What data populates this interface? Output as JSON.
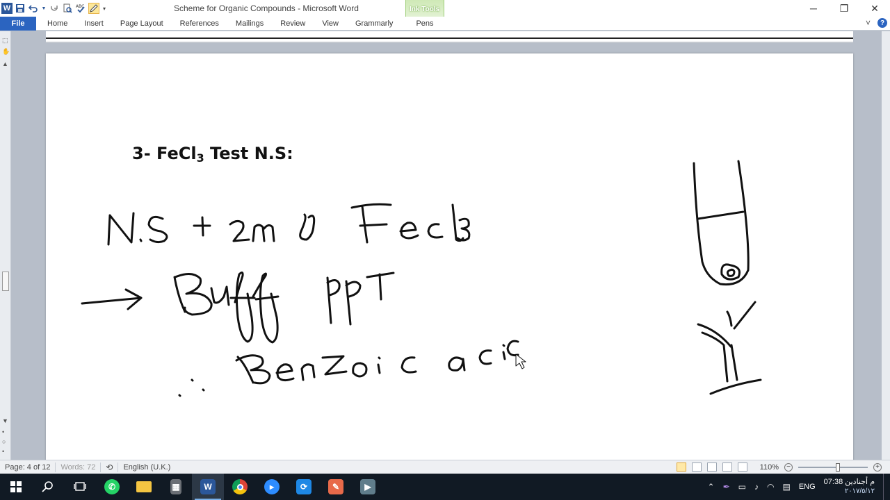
{
  "window": {
    "title": "Scheme for Organic Compounds - Microsoft Word",
    "app_icon": "W",
    "contextual_group": "Ink Tools",
    "controls": {
      "minimize": "─",
      "maximize": "❐",
      "close": "✕"
    }
  },
  "qat": [
    "save-icon",
    "undo-icon",
    "redo-icon",
    "print-preview-icon",
    "spelling-icon",
    "pen-icon",
    "customize-icon"
  ],
  "ribbon": {
    "tabs": [
      "File",
      "Home",
      "Insert",
      "Page Layout",
      "References",
      "Mailings",
      "Review",
      "View",
      "Grammarly"
    ],
    "contextual_tab": "Pens",
    "collapse_glyph": "˅",
    "help_glyph": "?"
  },
  "document": {
    "heading_prefix": "3- FeCl",
    "heading_subscript": "3",
    "heading_suffix": " Test N.S:",
    "ink_lines": [
      "N.S + 2ml FeCl3",
      "→ Buff ppt",
      "∴ Benzoic acid"
    ]
  },
  "status": {
    "page": "Page: 4 of 12",
    "words": "Words: 72",
    "language": "English (U.K.)",
    "zoom": "110%",
    "zoom_minus": "−",
    "zoom_plus": "+"
  },
  "taskbar": {
    "apps": [
      "start-icon",
      "search-icon",
      "task-view-icon",
      "whatsapp-icon",
      "file-explorer-icon",
      "calculator-icon",
      "word-icon",
      "chrome-icon",
      "zoom-icon",
      "app-icon",
      "paint-icon",
      "video-icon"
    ],
    "language": "ENG",
    "time": "07:38 م",
    "day": "أجنادين",
    "date": "٢٠١٧/٥/١٢"
  },
  "colors": {
    "file_tab": "#2b64c0",
    "ink_tools": "#9fcf7a",
    "taskbar": "#111a24",
    "page_bg": "#ffffff",
    "workspace": "#b7bec9"
  }
}
